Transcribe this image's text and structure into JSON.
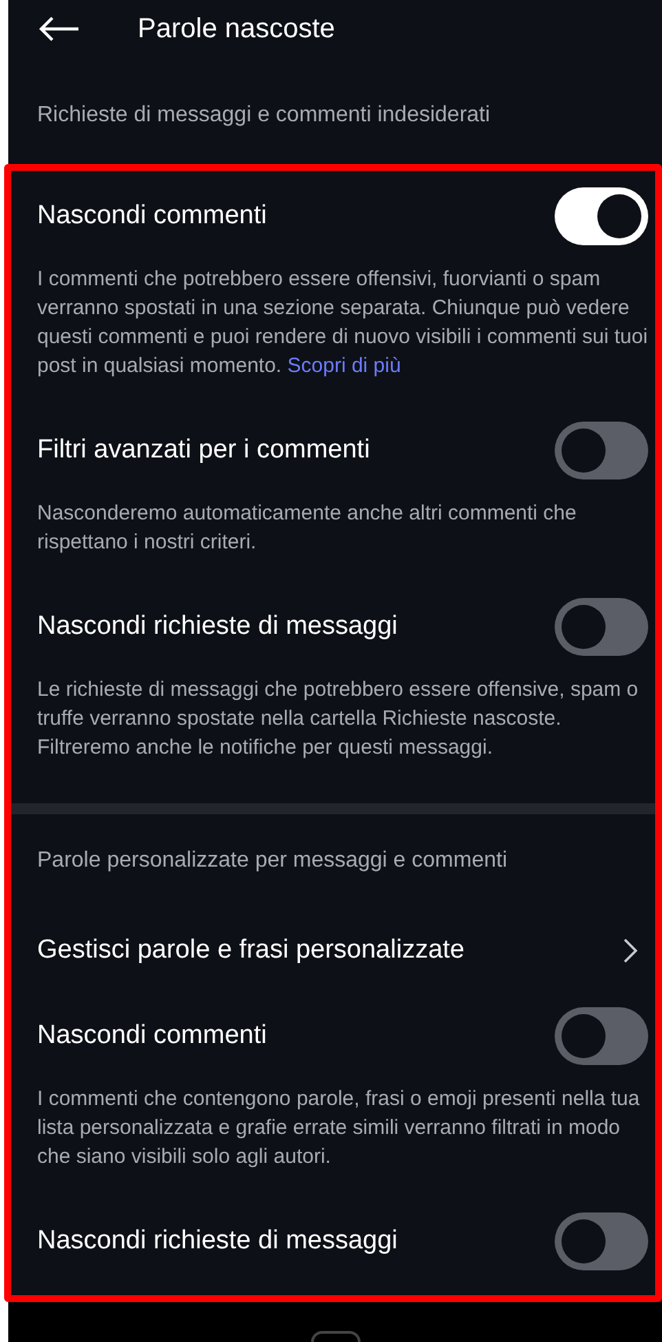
{
  "header": {
    "title": "Parole nascoste"
  },
  "sections": [
    {
      "heading": "Richieste di messaggi e commenti indesiderati",
      "items": [
        {
          "kind": "toggle",
          "label": "Nascondi commenti",
          "on": true,
          "description": "I commenti che potrebbero essere offensivi, fuorvianti o spam verranno spostati in una sezione separata. Chiunque può vedere questi commenti e puoi rendere di nuovo visibili i commenti sui tuoi post in qualsiasi momento.",
          "link": "Scopri di più"
        },
        {
          "kind": "toggle",
          "label": "Filtri avanzati per i commenti",
          "on": false,
          "description": "Nasconderemo automaticamente anche altri commenti che rispettano i nostri criteri."
        },
        {
          "kind": "toggle",
          "label": "Nascondi richieste di messaggi",
          "on": false,
          "description": "Le richieste di messaggi che potrebbero essere offensive, spam o truffe verranno spostate nella cartella Richieste nascoste. Filtreremo anche le notifiche per questi messaggi."
        }
      ]
    },
    {
      "heading": "Parole personalizzate per messaggi e commenti",
      "items": [
        {
          "kind": "link",
          "label": "Gestisci parole e frasi personalizzate"
        },
        {
          "kind": "toggle",
          "label": "Nascondi commenti",
          "on": false,
          "description": "I commenti che contengono parole, frasi o emoji presenti nella tua lista personalizzata e grafie errate simili verranno filtrati in modo che siano visibili solo agli autori."
        },
        {
          "kind": "toggle",
          "label": "Nascondi richieste di messaggi",
          "on": false
        }
      ]
    }
  ]
}
